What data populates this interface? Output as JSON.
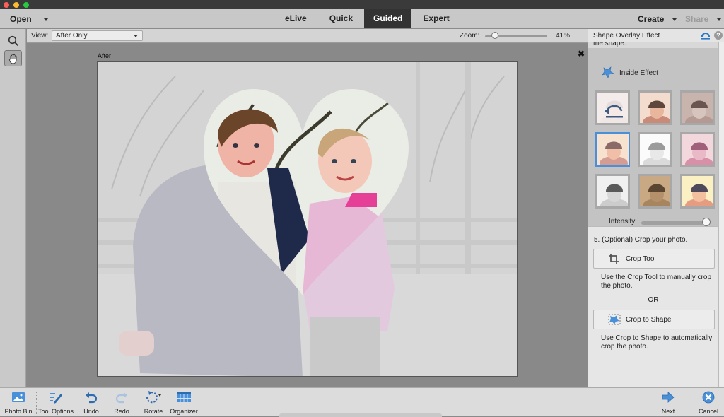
{
  "window": {
    "traffic_lights": {
      "close": "#ff5f57",
      "minimize": "#febc2e",
      "zoom": "#28c840"
    }
  },
  "menubar": {
    "open_label": "Open",
    "modes": [
      {
        "label": "eLive",
        "active": false
      },
      {
        "label": "Quick",
        "active": false
      },
      {
        "label": "Guided",
        "active": true
      },
      {
        "label": "Expert",
        "active": false
      }
    ],
    "create_label": "Create",
    "share_label": "Share"
  },
  "tools": [
    {
      "name": "zoom-tool",
      "icon": "magnifier-icon",
      "selected": false
    },
    {
      "name": "hand-tool",
      "icon": "hand-icon",
      "selected": true
    }
  ],
  "options_bar": {
    "view_label": "View:",
    "view_value": "After Only",
    "zoom_label": "Zoom:",
    "zoom_value": "41%",
    "zoom_percent": 41
  },
  "canvas": {
    "after_label": "After",
    "close_symbol": "✖"
  },
  "panel": {
    "title": "Shape Overlay Effect",
    "cutoff_text": "the shape.",
    "inside_effect_label": "Inside Effect",
    "effects": [
      {
        "name": "none",
        "tone": "reset"
      },
      {
        "name": "warm",
        "tone": "warm"
      },
      {
        "name": "vignette-sepia",
        "tone": "vignette"
      },
      {
        "name": "soft-warm",
        "tone": "softwarm",
        "selected": true
      },
      {
        "name": "sketch",
        "tone": "sketch"
      },
      {
        "name": "pink",
        "tone": "pink"
      },
      {
        "name": "black-white",
        "tone": "bw"
      },
      {
        "name": "sepia-grain",
        "tone": "sepia"
      },
      {
        "name": "yellow-vivid",
        "tone": "yellow"
      }
    ],
    "intensity_label": "Intensity",
    "intensity_value": 1.0,
    "step5_label": "5. (Optional) Crop your photo.",
    "crop_tool_label": "Crop Tool",
    "crop_tool_desc": "Use the Crop Tool to manually crop the photo.",
    "or_label": "OR",
    "crop_shape_label": "Crop to Shape",
    "crop_shape_desc": "Use Crop to Shape to automatically crop the photo."
  },
  "bottombar": {
    "left": [
      {
        "label": "Photo Bin",
        "icon": "photo-bin-icon"
      },
      {
        "label": "Tool Options",
        "icon": "tool-options-icon"
      },
      {
        "label": "Undo",
        "icon": "undo-icon"
      },
      {
        "label": "Redo",
        "icon": "redo-icon"
      },
      {
        "label": "Rotate",
        "icon": "rotate-icon"
      },
      {
        "label": "Organizer",
        "icon": "organizer-icon"
      }
    ],
    "right": [
      {
        "label": "Next",
        "icon": "next-arrow-icon"
      },
      {
        "label": "Cancel",
        "icon": "cancel-icon"
      }
    ]
  }
}
